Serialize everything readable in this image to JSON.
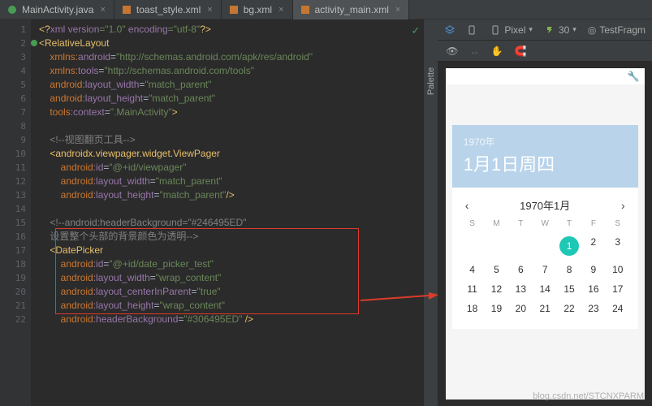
{
  "tabs": [
    {
      "icon": "#499c54",
      "label": "MainActivity.java",
      "active": false
    },
    {
      "icon": "#c57633",
      "label": "toast_style.xml",
      "active": false
    },
    {
      "icon": "#c57633",
      "label": "bg.xml",
      "active": false
    },
    {
      "icon": "#c57633",
      "label": "activity_main.xml",
      "active": true
    }
  ],
  "code": {
    "lines": [
      "1",
      "2",
      "3",
      "4",
      "5",
      "6",
      "7",
      "8",
      "9",
      "10",
      "11",
      "12",
      "13",
      "14",
      "15",
      "16",
      "17",
      "18",
      "19",
      "20",
      "21",
      "22"
    ],
    "l1a": "<?",
    "l1b": "xml version",
    "l1c": "=\"1.0\" ",
    "l1d": "encoding",
    "l1e": "=\"utf-8\"",
    "l1f": "?>",
    "l2a": "<",
    "l2b": "RelativeLayout",
    "l3a": "xmlns:",
    "l3b": "android",
    "l3c": "=",
    "l3d": "\"http://schemas.android.com/apk/res/android\"",
    "l4a": "xmlns:",
    "l4b": "tools",
    "l4c": "=",
    "l4d": "\"http://schemas.android.com/tools\"",
    "l5a": "android",
    "l5b": ":layout_width",
    "l5c": "=",
    "l5d": "\"match_parent\"",
    "l6a": "android",
    "l6b": ":layout_height",
    "l6c": "=",
    "l6d": "\"match_parent\"",
    "l7a": "tools",
    "l7b": ":context",
    "l7c": "=",
    "l7d": "\".MainActivity\"",
    "l7e": ">",
    "l9": "<!--视图翻页工具-->",
    "l10a": "<",
    "l10b": "androidx.viewpager.widget.ViewPager",
    "l11a": "android",
    "l11b": ":id",
    "l11c": "=",
    "l11d": "\"@+id/viewpager\"",
    "l12a": "android",
    "l12b": ":layout_width",
    "l12c": "=",
    "l12d": "\"match_parent\"",
    "l13a": "android",
    "l13b": ":layout_height",
    "l13c": "=",
    "l13d": "\"match_parent\"",
    "l13e": "/>",
    "l15": "<!--android:headerBackground=\"#246495ED\"",
    "l16": "设置整个头部的背景颜色为透明-->",
    "l17a": "<",
    "l17b": "DatePicker",
    "l18a": "android",
    "l18b": ":id",
    "l18c": "=",
    "l18d": "\"@+id/date_picker_test\"",
    "l19a": "android",
    "l19b": ":layout_width",
    "l19c": "=",
    "l19d": "\"wrap_content\"",
    "l20a": "android",
    "l20b": ":layout_centerInParent",
    "l20c": "=",
    "l20d": "\"true\"",
    "l21a": "android",
    "l21b": ":layout_height",
    "l21c": "=",
    "l21d": "\"wrap_content\"",
    "l22a": "android",
    "l22b": ":headerBackground",
    "l22c": "=",
    "l22d": "\"#306495ED\"",
    "l22e": " />"
  },
  "designer": {
    "device": "Pixel",
    "api": "30",
    "fragment": "TestFragm",
    "palette": "Palette",
    "datepicker": {
      "year": "1970年",
      "bigdate": "1月1日周四",
      "month": "1970年1月",
      "dh": [
        "S",
        "M",
        "T",
        "W",
        "T",
        "F",
        "S"
      ],
      "grid": [
        [
          "",
          "",
          "",
          "",
          "1",
          "2",
          "3"
        ],
        [
          "4",
          "5",
          "6",
          "7",
          "8",
          "9",
          "10"
        ],
        [
          "11",
          "12",
          "13",
          "14",
          "15",
          "16",
          "17"
        ],
        [
          "18",
          "19",
          "20",
          "21",
          "22",
          "23",
          "24"
        ]
      ],
      "today": "1"
    }
  },
  "watermark": "blog.csdn.net/STCNXPARM"
}
